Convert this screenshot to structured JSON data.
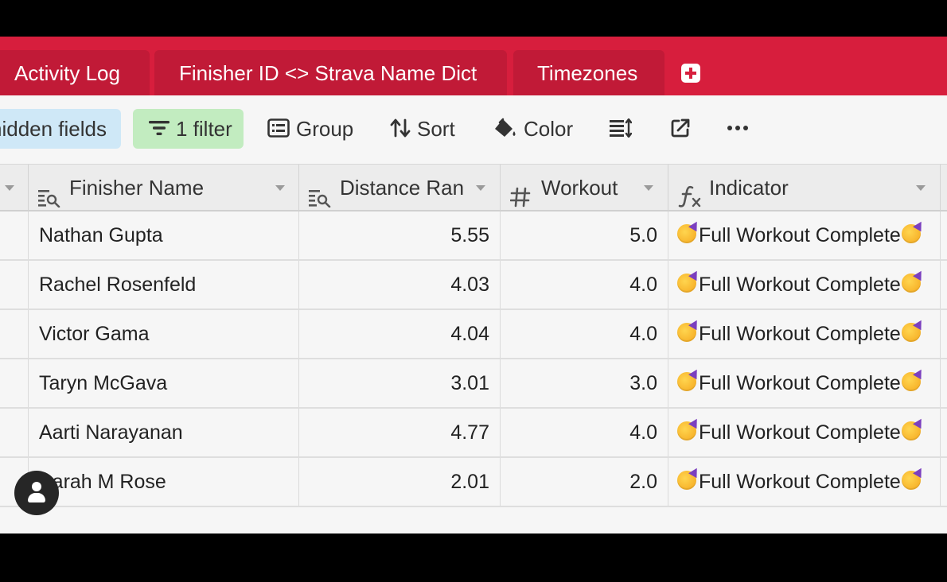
{
  "tabs": [
    {
      "label": "Activity Log"
    },
    {
      "label": "Finisher ID <> Strava Name Dict"
    },
    {
      "label": "Timezones"
    }
  ],
  "toolbar": {
    "hidden_fields_label": "hidden fields",
    "filter_label": "1 filter",
    "group_label": "Group",
    "sort_label": "Sort",
    "color_label": "Color"
  },
  "columns": [
    {
      "label": "Finisher Name",
      "icon": "lookup-icon"
    },
    {
      "label": "Distance Ran",
      "icon": "lookup-icon"
    },
    {
      "label": "Workout",
      "icon": "number-icon"
    },
    {
      "label": "Indicator",
      "icon": "formula-icon"
    }
  ],
  "rows": [
    {
      "name": "Nathan Gupta",
      "distance": "5.55",
      "workout": "5.0",
      "indicator": "Full Workout Complete"
    },
    {
      "name": "Rachel Rosenfeld",
      "distance": "4.03",
      "workout": "4.0",
      "indicator": "Full Workout Complete"
    },
    {
      "name": "Victor Gama",
      "distance": "4.04",
      "workout": "4.0",
      "indicator": "Full Workout Complete"
    },
    {
      "name": "Taryn McGava",
      "distance": "3.01",
      "workout": "3.0",
      "indicator": "Full Workout Complete"
    },
    {
      "name": "Aarti Narayanan",
      "distance": "4.77",
      "workout": "4.0",
      "indicator": "Full Workout Complete"
    },
    {
      "name": "Sarah M Rose",
      "distance": "2.01",
      "workout": "2.0",
      "indicator": "Full Workout Complete"
    }
  ],
  "colors": {
    "tab_bar": "#d71e3d",
    "hidden_fields_bg": "#cfe8f7",
    "filter_bg": "#c2ecc0"
  }
}
